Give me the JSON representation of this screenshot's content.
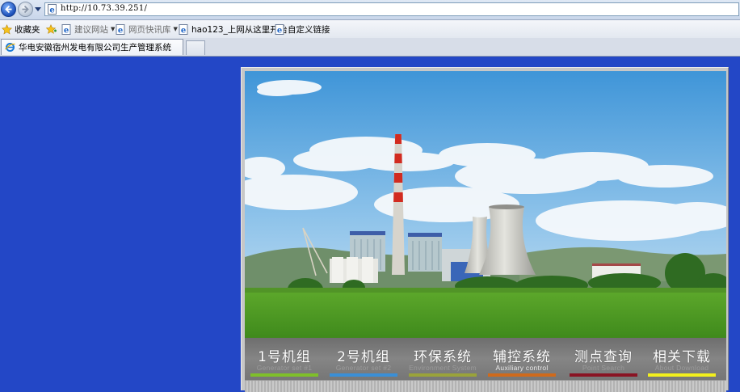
{
  "browser": {
    "url": "http://10.73.39.251/",
    "favorites_label": "收藏夹",
    "favorites_bar": [
      {
        "label": "建议网站",
        "has_dropdown": true,
        "dimmed": true
      },
      {
        "label": "网页快讯库",
        "has_dropdown": true,
        "dimmed": true
      },
      {
        "label": "hao123_上网从这里开始",
        "has_dropdown": false,
        "dimmed": false
      },
      {
        "label": "自定义链接",
        "has_dropdown": false,
        "dimmed": false
      }
    ],
    "tab_title": "华电安徽宿州发电有限公司生产管理系统"
  },
  "page": {
    "background_color": "#2347c6",
    "banner_image": "power-plant-photo",
    "menu": [
      {
        "cn": "1号机组",
        "en": "Generator set #1",
        "color": "#7fbf2a",
        "en_highlight": false
      },
      {
        "cn": "2号机组",
        "en": "Generator set #2",
        "color": "#3a8fd6",
        "en_highlight": false
      },
      {
        "cn": "环保系统",
        "en": "Environment System",
        "color": "#9aa33a",
        "en_highlight": false
      },
      {
        "cn": "辅控系统",
        "en": "Auxiliary control",
        "color": "#cf6a1c",
        "en_highlight": true
      },
      {
        "cn": "测点查询",
        "en": "Point Search",
        "color": "#8a1323",
        "en_highlight": false
      },
      {
        "cn": "相关下载",
        "en": "About Download",
        "color": "#f3ef1c",
        "en_highlight": false
      }
    ]
  }
}
